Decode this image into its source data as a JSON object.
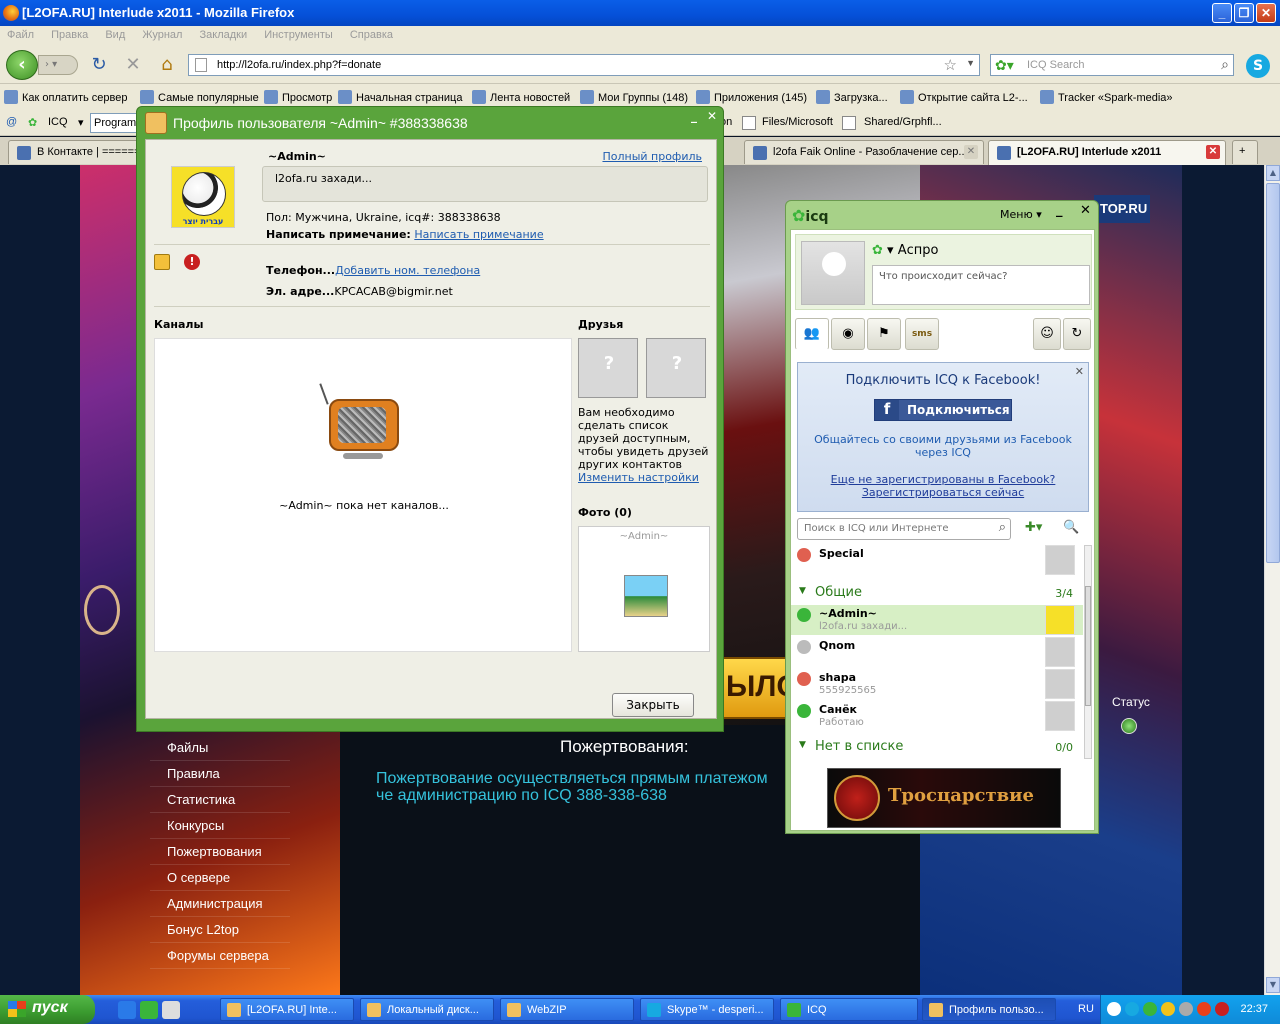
{
  "window": {
    "title": "[L2OFA.RU] Interlude x2011 - Mozilla Firefox"
  },
  "menu": [
    "Файл",
    "Правка",
    "Вид",
    "Журнал",
    "Закладки",
    "Инструменты",
    "Справка"
  ],
  "nav": {
    "url": "http://l2ofa.ru/index.php?f=donate",
    "search_placeholder": "ICQ Search"
  },
  "bookmarks": [
    "Как оплатить сервер",
    "Самые популярные",
    "Просмотр",
    "Начальная страница",
    "Лента новостей",
    "Мои Группы (148)",
    "Приложения (145)",
    "Загрузка...",
    "Открытие сайта L2-...",
    "Tracker «Spark-media»"
  ],
  "icqbar": {
    "label": "ICQ",
    "program_label": "Program",
    "item1": "Files/Microsoft",
    "item2": "Shared/Grphfl..."
  },
  "tabs": [
    {
      "label": "В Контакте | ==========="
    },
    {
      "label": "l2ofa Faik Online - Разоблачение сер..."
    },
    {
      "label": "[L2OFA.RU] Interlude x2011"
    }
  ],
  "site": {
    "banner_text": "ЫЛО",
    "topru": "TOP.RU",
    "sidebar": [
      "Файлы",
      "Правила",
      "Статистика",
      "Конкурсы",
      "Пожертвования",
      "О сервере",
      "Администрация",
      "Бонус L2top",
      "Форумы сервера"
    ],
    "donate_title": "Пожертвования:",
    "donate_text": "Пожертвование осуществляеться прямым платежом че администрацию по ICQ 388-338-638",
    "status_label": "Статус"
  },
  "profile": {
    "title": "Профиль пользователя ~Admin~ #388338638",
    "name": "~Admin~",
    "full_profile": "Полный профиль",
    "status_text": "l2ofa.ru захади...",
    "avatar_caption": "עברית יוצר",
    "info_line": "Пол: Мужчина, Ukraine, icq#: 388338638",
    "note_label": "Написать примечание:",
    "note_link": "Написать примечание",
    "phone_label": "Телефон...",
    "phone_link": "Добавить ном. телефона",
    "email_label": "Эл. адре...",
    "email_value": "KPCACAB@bigmir.net",
    "channels_label": "Каналы",
    "channels_empty": "~Admin~ пока нет каналов...",
    "friends_label": "Друзья",
    "friends_text": "Вам необходимо сделать список друзей доступным, чтобы увидеть друзей других контактов",
    "friends_link": "Изменить настройки",
    "photo_label": "Фото (0)",
    "photo_name": "~Admin~",
    "close_button": "Закрыть"
  },
  "icq": {
    "title": "icq",
    "menu": "Меню",
    "my_name": "Аспро",
    "status_placeholder": "Что происходит сейчас?",
    "fb_heading": "Подключить ICQ к Facebook!",
    "fb_button": "Подключиться",
    "fb_text": "Общайтесь со своими друзьями из Facebook через ICQ",
    "fb_link1": "Еще не зарегистрированы в Facebook?",
    "fb_link2": "Зарегистрироваться сейчас",
    "search_placeholder": "Поиск в ICQ или Интернете",
    "special": "Special",
    "group_general": "Общие",
    "group_general_count": "3/4",
    "contacts": [
      {
        "name": "~Admin~",
        "sub": "l2ofa.ru захади..."
      },
      {
        "name": "Qnom",
        "sub": ""
      },
      {
        "name": "shapa",
        "sub": "555925565"
      },
      {
        "name": "Санёк",
        "sub": "Работаю"
      }
    ],
    "group_notinlist": "Нет в списке",
    "group_notinlist_count": "0/0",
    "ad_text": "Тросцарствие"
  },
  "taskbar": {
    "start": "пуск",
    "items": [
      "[L2OFA.RU] Inte...",
      "Локальный диск...",
      "WebZIP",
      "Skype™ - desperi...",
      "ICQ",
      "Профиль пользо..."
    ],
    "lang": "RU",
    "time": "22:37"
  }
}
